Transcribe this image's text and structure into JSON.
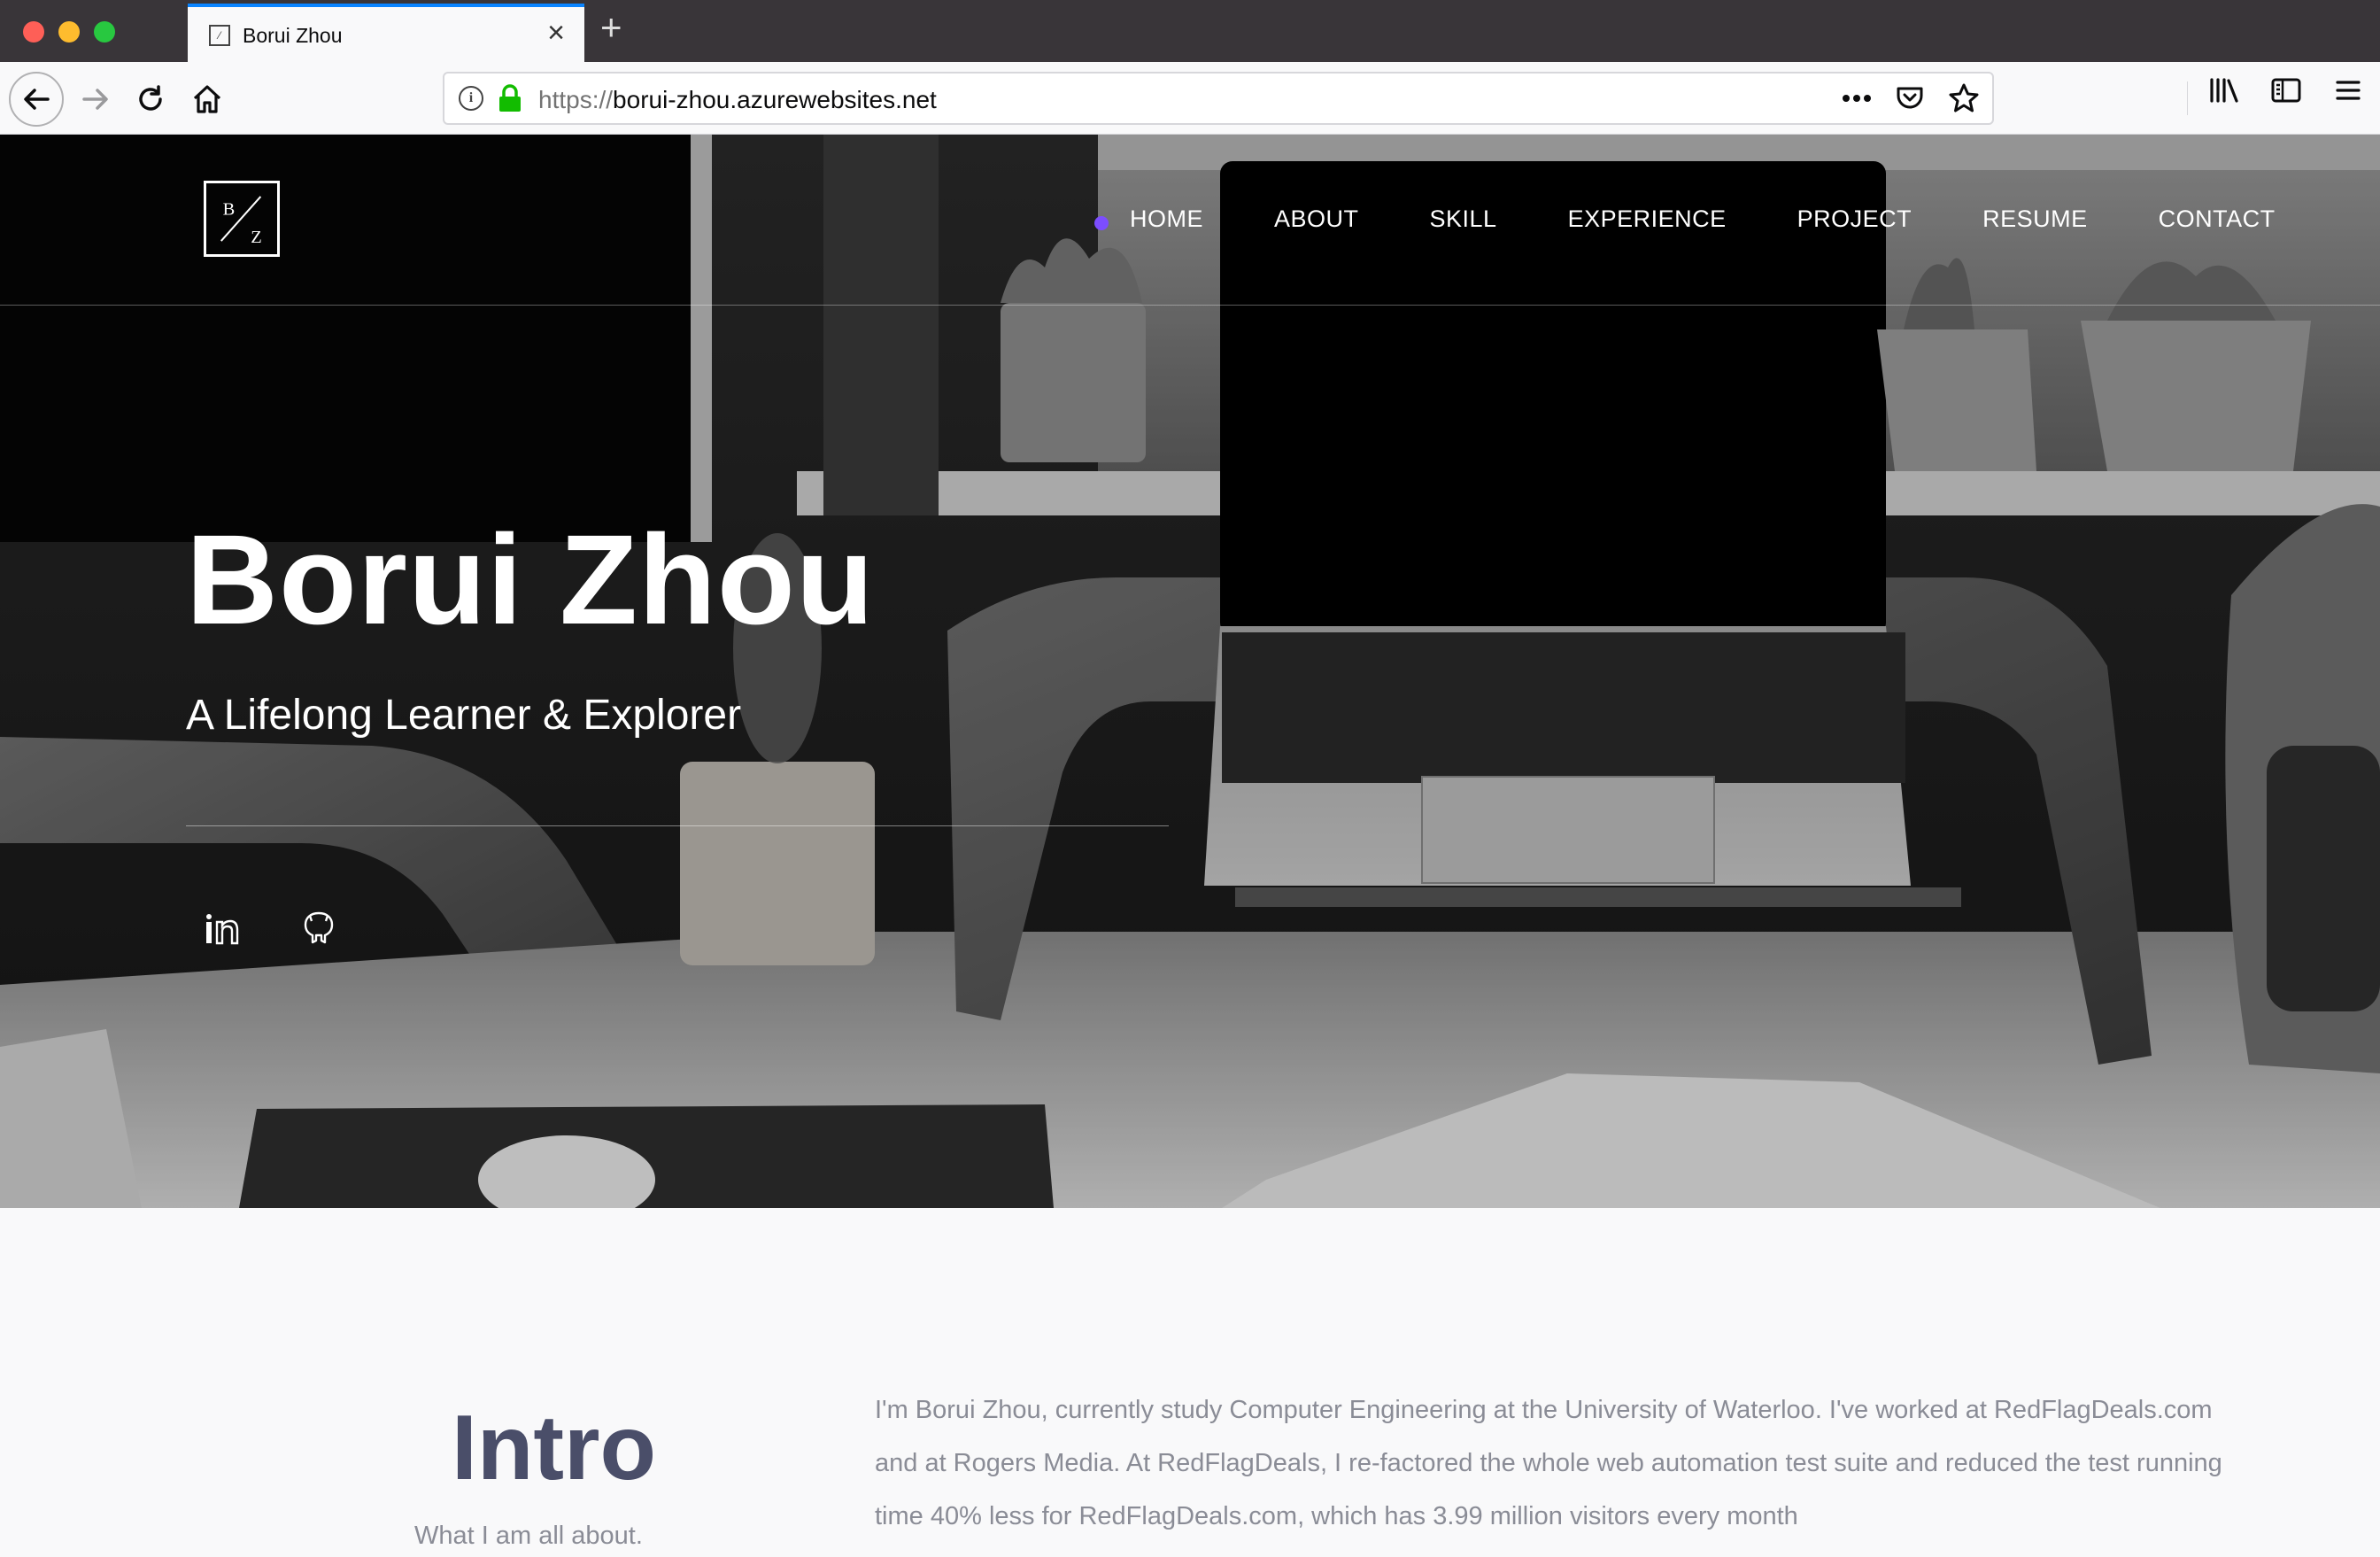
{
  "browser": {
    "tab_title": "Borui Zhou",
    "url_scheme": "https://",
    "url_host": "borui-zhou.azurewebsites.net"
  },
  "header": {
    "logo_text": "B/Z",
    "nav": [
      {
        "label": "HOME",
        "active": true
      },
      {
        "label": "ABOUT"
      },
      {
        "label": "SKILL"
      },
      {
        "label": "EXPERIENCE"
      },
      {
        "label": "PROJECT"
      },
      {
        "label": "RESUME"
      },
      {
        "label": "CONTACT"
      }
    ]
  },
  "hero": {
    "title": "Borui Zhou",
    "subtitle": "A Lifelong Learner & Explorer",
    "social": [
      "linkedin-icon",
      "github-icon"
    ]
  },
  "intro": {
    "title": "Intro",
    "subtitle": "What I am all about.",
    "text": "I'm Borui Zhou, currently study Computer Engineering at the University of Waterloo. I've worked at RedFlagDeals.com and at Rogers Media. At RedFlagDeals, I re-factored the whole web automation test suite and reduced the test running time 40% less for RedFlagDeals.com, which has 3.99 million visitors every month"
  },
  "colors": {
    "accent": "#7c4dff",
    "intro_heading": "#4a4e69",
    "body_text": "#8a8c96",
    "tab_highlight": "#0a84ff"
  }
}
